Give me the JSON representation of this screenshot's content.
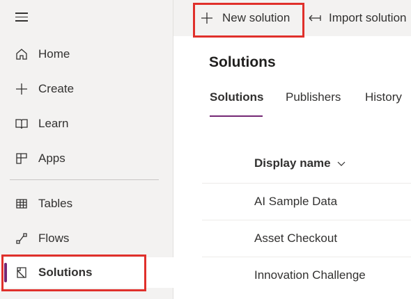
{
  "sidebar": {
    "items": [
      {
        "label": "Home",
        "icon": "home-icon"
      },
      {
        "label": "Create",
        "icon": "plus-icon"
      },
      {
        "label": "Learn",
        "icon": "book-icon"
      },
      {
        "label": "Apps",
        "icon": "apps-icon"
      },
      {
        "label": "Tables",
        "icon": "table-icon"
      },
      {
        "label": "Flows",
        "icon": "flow-icon"
      },
      {
        "label": "Solutions",
        "icon": "solutions-icon",
        "selected": true
      }
    ]
  },
  "commandbar": {
    "new_solution": "New solution",
    "import_solution": "Import solution"
  },
  "main": {
    "title": "Solutions",
    "tabs": [
      "Solutions",
      "Publishers",
      "History"
    ],
    "active_tab": "Solutions",
    "column_header": "Display name",
    "rows": [
      "AI Sample Data",
      "Asset Checkout",
      "Innovation Challenge"
    ]
  },
  "colors": {
    "accent": "#742774",
    "highlight": "#e0302b",
    "sidebar_bg": "#f3f2f1"
  }
}
